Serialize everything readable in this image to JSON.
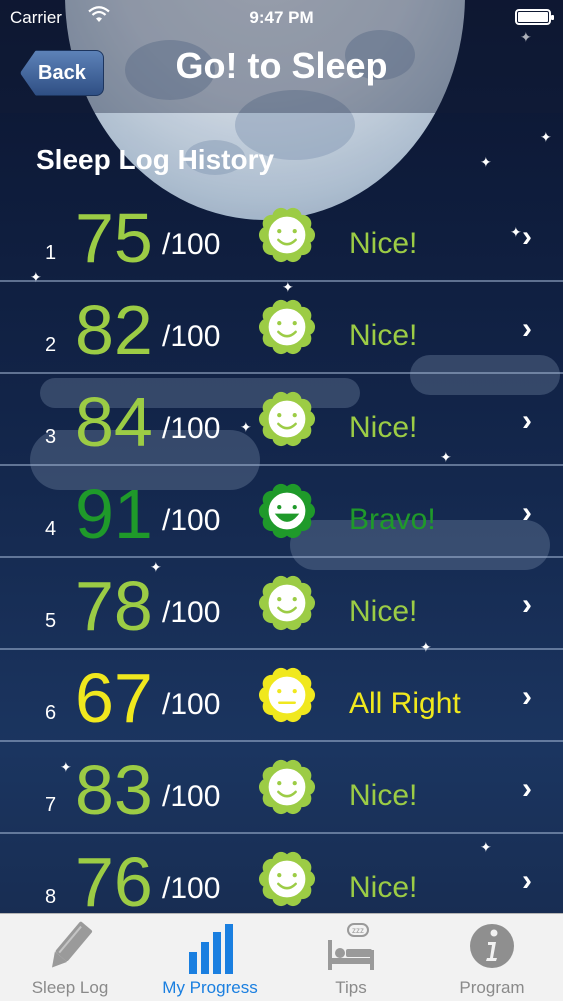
{
  "status_bar": {
    "carrier": "Carrier",
    "time": "9:47 PM"
  },
  "nav": {
    "back_label": "Back",
    "title": "Go! to Sleep"
  },
  "section_title": "Sleep Log History",
  "colors": {
    "nice": "#9ccc45",
    "bravo": "#1f9a2a",
    "all_right": "#f0e81e",
    "active_tab": "#1a7fe0"
  },
  "entries": [
    {
      "index": "1",
      "score": "75",
      "denom": "/100",
      "rating": "Nice!",
      "mood": "nice"
    },
    {
      "index": "2",
      "score": "82",
      "denom": "/100",
      "rating": "Nice!",
      "mood": "nice"
    },
    {
      "index": "3",
      "score": "84",
      "denom": "/100",
      "rating": "Nice!",
      "mood": "nice"
    },
    {
      "index": "4",
      "score": "91",
      "denom": "/100",
      "rating": "Bravo!",
      "mood": "bravo"
    },
    {
      "index": "5",
      "score": "78",
      "denom": "/100",
      "rating": "Nice!",
      "mood": "nice"
    },
    {
      "index": "6",
      "score": "67",
      "denom": "/100",
      "rating": "All Right",
      "mood": "all_right"
    },
    {
      "index": "7",
      "score": "83",
      "denom": "/100",
      "rating": "Nice!",
      "mood": "nice"
    },
    {
      "index": "8",
      "score": "76",
      "denom": "/100",
      "rating": "Nice!",
      "mood": "nice"
    }
  ],
  "tabs": [
    {
      "label": "Sleep Log",
      "icon": "pencil-icon"
    },
    {
      "label": "My Progress",
      "icon": "bar-chart-icon",
      "active": true
    },
    {
      "label": "Tips",
      "icon": "bed-icon"
    },
    {
      "label": "Program",
      "icon": "info-icon"
    }
  ]
}
